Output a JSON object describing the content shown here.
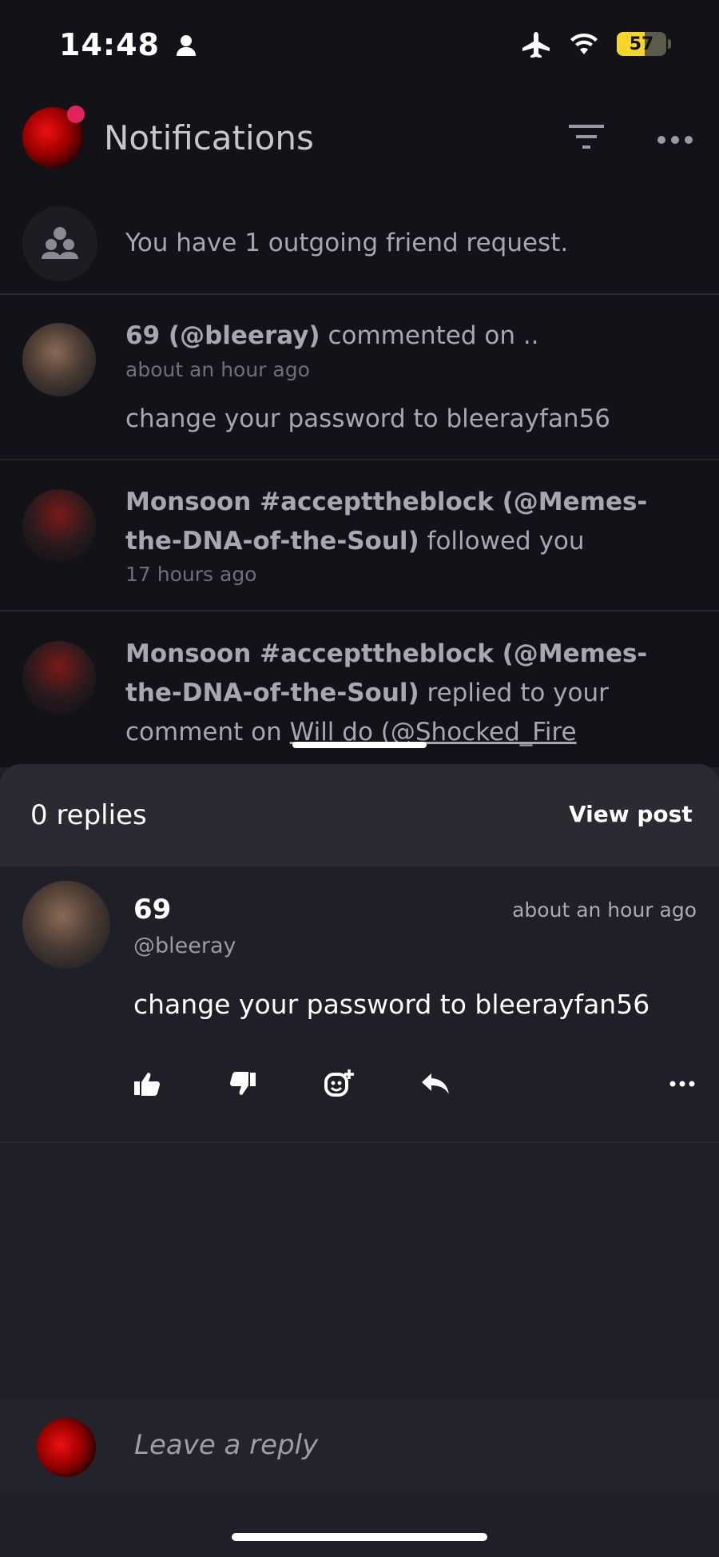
{
  "status_bar": {
    "time": "14:48",
    "battery_level": "57"
  },
  "header": {
    "title": "Notifications"
  },
  "notifications": [
    {
      "text": "You have 1 outgoing friend request."
    },
    {
      "name": "69 (@bleeray)",
      "action": "commented on ..",
      "time": "about an hour ago",
      "preview": "change your password to bleerayfan56"
    },
    {
      "name_line1": "Monsoon #accepttheblock (@Memes-",
      "name_line2": "the-DNA-of-the-Soul)",
      "action": "followed you",
      "time": "17 hours ago"
    },
    {
      "name_line1": "Monsoon #accepttheblock (@Memes-",
      "name_line2": "the-DNA-of-the-Soul)",
      "action": "replied to your",
      "action2": "comment on",
      "link": "Will do (@Shocked_Fire"
    }
  ],
  "sheet": {
    "replies_count": "0 replies",
    "view_post": "View post",
    "comment": {
      "author": "69",
      "handle": "@bleeray",
      "time": "about an hour ago",
      "body": "change your password to bleerayfan56"
    },
    "reply_placeholder": "Leave a reply"
  },
  "colors": {
    "background": "#1f1f27",
    "accent_dot": "#e0245e",
    "battery": "#f5d52a"
  }
}
